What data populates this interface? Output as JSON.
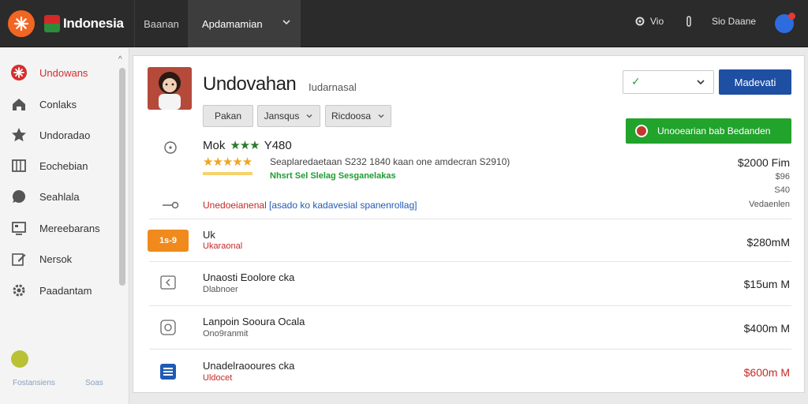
{
  "topbar": {
    "brand": "Indonesia",
    "nav_1": "Baanan",
    "nav_2": "Apdamamian",
    "right_1": "Vio",
    "right_2": "Sio Daane",
    "colors": {
      "bar": "#2b2b2b",
      "logo": "#f26522"
    }
  },
  "sidebar": {
    "items": [
      {
        "label": "Undowans",
        "icon": "asterisk-icon",
        "active": true
      },
      {
        "label": "Conlaks",
        "icon": "home-icon"
      },
      {
        "label": "Undoradao",
        "icon": "star-icon"
      },
      {
        "label": "Eochebian",
        "icon": "grid-icon"
      },
      {
        "label": "Seahlala",
        "icon": "chat-bubble-icon"
      },
      {
        "label": "Mereebarans",
        "icon": "monitor-icon"
      },
      {
        "label": "Nersok",
        "icon": "edit-icon"
      },
      {
        "label": "Paadantam",
        "icon": "gear-icon"
      }
    ],
    "footer_left": "Fostansiens",
    "footer_right": "Soas"
  },
  "header": {
    "title": "Undovahan",
    "subtitle": "Iudarnasal",
    "select_value": "",
    "primary_button": "Madevati",
    "green_button": "Unooearian bab Bedanden",
    "chips": [
      {
        "label": "Pakan",
        "has_chevron": false
      },
      {
        "label": "Jansqus",
        "has_chevron": true
      },
      {
        "label": "Ricdoosa",
        "has_chevron": true
      }
    ]
  },
  "listing": {
    "prefix": "Mok",
    "stars_green": "★★★",
    "code": "Y480",
    "stars_yellow": "★★★★★",
    "rating_fill": 0.9,
    "review_text": "Seaplaredaetaan S232 1840 kaan one amdecran S2910)",
    "green_link": "Nhsrt Sel Slelag Sesganelakas",
    "price": "$2000 Fim",
    "price_sub_1": "$96",
    "price_sub_2": "S40",
    "red_text": "Unedoeianenal",
    "blue_text": "[asado ko kadavesial spanenrollag]",
    "side_note": "Vedaenlen"
  },
  "rows": [
    {
      "title": "Uk",
      "sub": "Ukaraonal",
      "sub_red": true,
      "price": "$280mM",
      "price_red": false,
      "icon": "tag-badge-icon",
      "badge": "1s-9"
    },
    {
      "title": "Unaosti Eoolore cka",
      "sub": "Dlabnoer",
      "sub_red": false,
      "price": "$15um M",
      "price_red": false,
      "icon": "back-arrow-icon"
    },
    {
      "title": "Lanpoin Sooura Ocala",
      "sub": "Ono9ranmit",
      "sub_red": false,
      "price": "$400m M",
      "price_red": false,
      "icon": "circle-icon"
    },
    {
      "title": "Unadelraooures cka",
      "sub": "Uldocet",
      "sub_red": true,
      "price": "$600m M",
      "price_red": true,
      "icon": "document-icon"
    }
  ]
}
